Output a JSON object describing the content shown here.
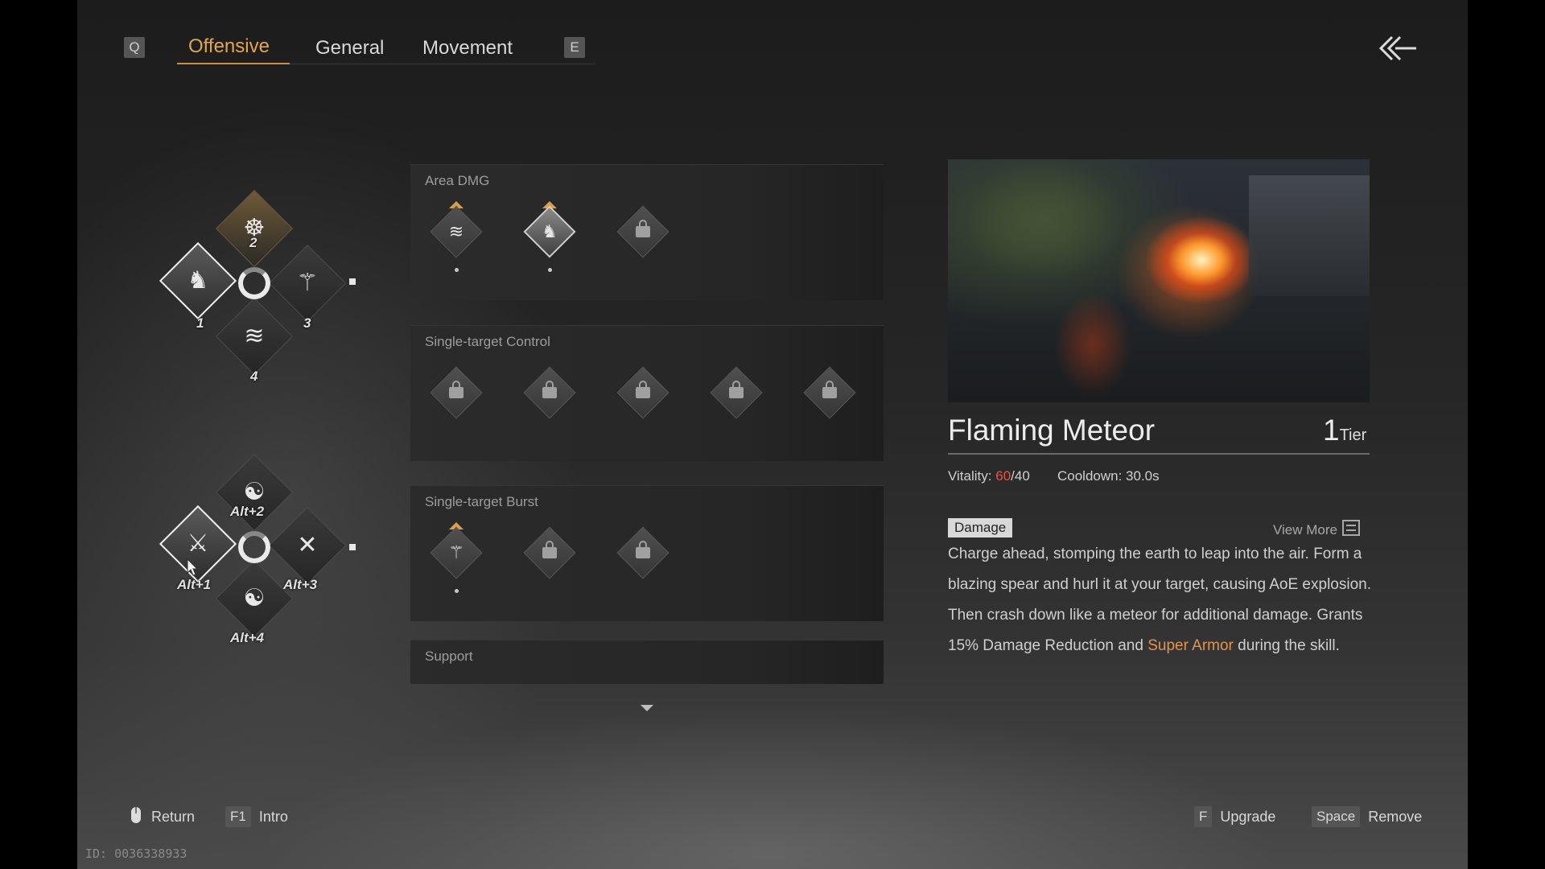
{
  "tabs": {
    "left_key": "Q",
    "right_key": "E",
    "items": [
      {
        "label": "Offensive",
        "active": true
      },
      {
        "label": "General",
        "active": false
      },
      {
        "label": "Movement",
        "active": false
      }
    ]
  },
  "top_right": {
    "icon": "back-arrow-icon"
  },
  "wheel_1": {
    "labels": [
      "1",
      "2",
      "3",
      "4"
    ]
  },
  "wheel_2": {
    "labels": [
      "Alt+1",
      "Alt+2",
      "Alt+3",
      "Alt+4"
    ]
  },
  "categories": [
    {
      "title": "Area DMG"
    },
    {
      "title": "Single-target Control"
    },
    {
      "title": "Single-target Burst"
    },
    {
      "title": "Support"
    }
  ],
  "skill": {
    "name": "Flaming Meteor",
    "tier_number": "1",
    "tier_label": "Tier",
    "vitality_label": "Vitality:",
    "vitality_current": "60",
    "vitality_max": "/40",
    "cooldown": "Cooldown: 30.0s",
    "tag": "Damage",
    "view_more": "View More",
    "description_main": "Charge ahead, stomping the earth to leap into the air. Form a blazing spear and hurl it at your target, causing AoE explosion. Then crash down like a meteor for additional damage. Grants 15% Damage Reduction and",
    "description_highlight": "Super Armor",
    "description_tail": "during the skill."
  },
  "footer": {
    "return_label": "Return",
    "intro_key": "F1",
    "intro_label": "Intro",
    "upgrade_key": "F",
    "upgrade_label": "Upgrade",
    "remove_key": "Space",
    "remove_label": "Remove",
    "id_text": "ID: 0036338933"
  }
}
